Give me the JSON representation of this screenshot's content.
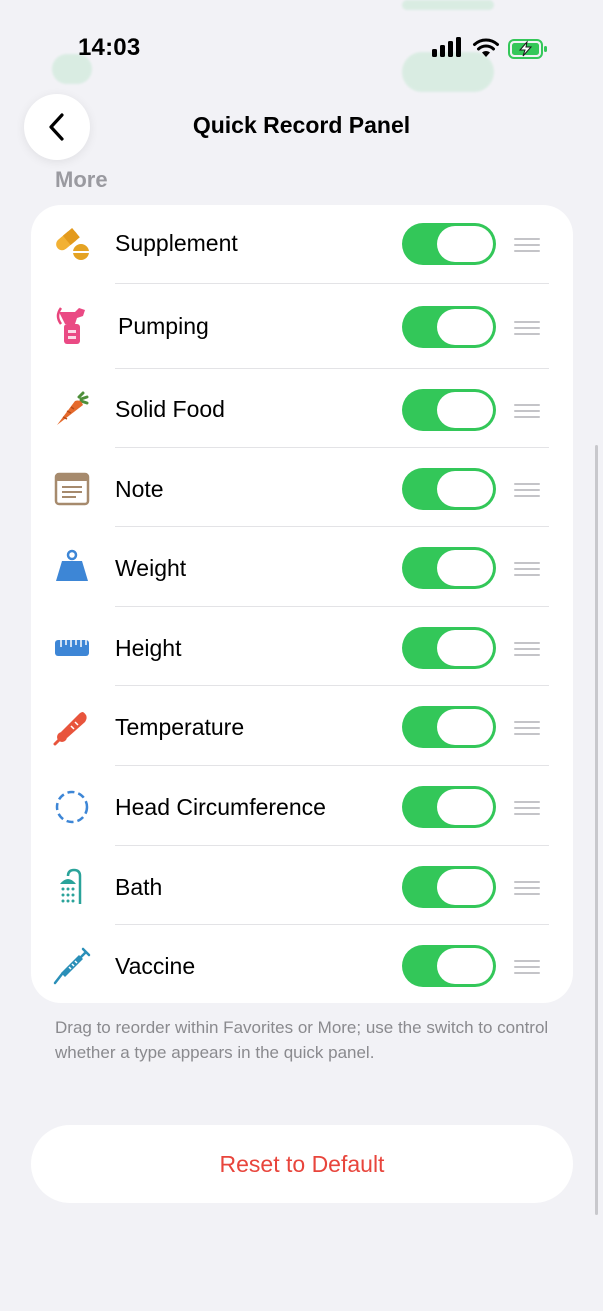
{
  "status_bar": {
    "time": "14:03"
  },
  "header": {
    "title": "Quick Record Panel",
    "back_icon": "chevron-left-icon"
  },
  "section": {
    "label": "More"
  },
  "items": [
    {
      "label": "Supplement",
      "icon": "pill-icon",
      "enabled": true
    },
    {
      "label": "Pumping",
      "icon": "breast-pump-icon",
      "enabled": true
    },
    {
      "label": "Solid Food",
      "icon": "carrot-icon",
      "enabled": true
    },
    {
      "label": "Note",
      "icon": "note-icon",
      "enabled": true
    },
    {
      "label": "Weight",
      "icon": "weight-icon",
      "enabled": true
    },
    {
      "label": "Height",
      "icon": "ruler-icon",
      "enabled": true
    },
    {
      "label": "Temperature",
      "icon": "thermometer-icon",
      "enabled": true
    },
    {
      "label": "Head Circumference",
      "icon": "dashed-circle-icon",
      "enabled": true
    },
    {
      "label": "Bath",
      "icon": "shower-icon",
      "enabled": true
    },
    {
      "label": "Vaccine",
      "icon": "syringe-icon",
      "enabled": true
    }
  ],
  "footnote": "Drag to reorder within Favorites or More; use the switch to control whether a type appears in the quick panel.",
  "reset_button": {
    "label": "Reset to Default"
  },
  "colors": {
    "toggle_on": "#33c759",
    "destructive": "#e8453c",
    "background": "#f2f2f6"
  }
}
